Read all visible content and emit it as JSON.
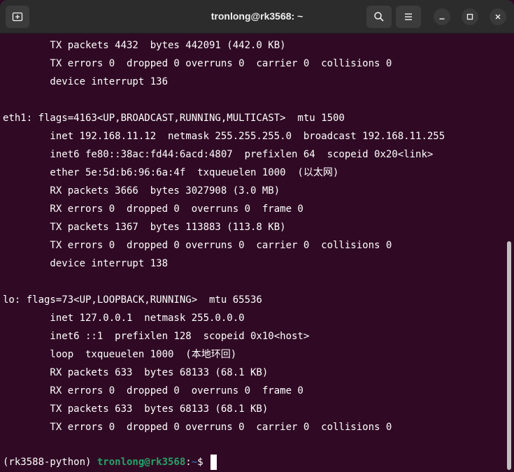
{
  "window": {
    "title": "tronlong@rk3568: ~"
  },
  "titlebar": {
    "new_tab_icon": "new-tab-icon",
    "search_icon": "search-icon",
    "menu_icon": "hamburger-menu-icon",
    "minimize_icon": "minimize-icon",
    "maximize_icon": "maximize-icon",
    "close_icon": "close-icon"
  },
  "terminal": {
    "lines": [
      "        TX packets 4432  bytes 442091 (442.0 KB)",
      "        TX errors 0  dropped 0 overruns 0  carrier 0  collisions 0",
      "        device interrupt 136",
      "",
      "eth1: flags=4163<UP,BROADCAST,RUNNING,MULTICAST>  mtu 1500",
      "        inet 192.168.11.12  netmask 255.255.255.0  broadcast 192.168.11.255",
      "        inet6 fe80::38ac:fd44:6acd:4807  prefixlen 64  scopeid 0x20<link>",
      "        ether 5e:5d:b6:96:6a:4f  txqueuelen 1000  (以太网)",
      "        RX packets 3666  bytes 3027908 (3.0 MB)",
      "        RX errors 0  dropped 0  overruns 0  frame 0",
      "        TX packets 1367  bytes 113883 (113.8 KB)",
      "        TX errors 0  dropped 0 overruns 0  carrier 0  collisions 0",
      "        device interrupt 138",
      "",
      "lo: flags=73<UP,LOOPBACK,RUNNING>  mtu 65536",
      "        inet 127.0.0.1  netmask 255.0.0.0",
      "        inet6 ::1  prefixlen 128  scopeid 0x10<host>",
      "        loop  txqueuelen 1000  (本地环回)",
      "        RX packets 633  bytes 68133 (68.1 KB)",
      "        RX errors 0  dropped 0  overruns 0  frame 0",
      "        TX packets 633  bytes 68133 (68.1 KB)",
      "        TX errors 0  dropped 0 overruns 0  carrier 0  collisions 0",
      ""
    ],
    "prompt": {
      "env": "(rk3588-python) ",
      "user_host": "tronlong@rk3568",
      "sep": ":",
      "dir": "~",
      "symbol": "$ "
    }
  },
  "colors": {
    "background": "#300a24",
    "titlebar": "#2c2c2c",
    "text": "#ffffff",
    "prompt_user": "#26a269",
    "prompt_dir": "#3465a4"
  }
}
